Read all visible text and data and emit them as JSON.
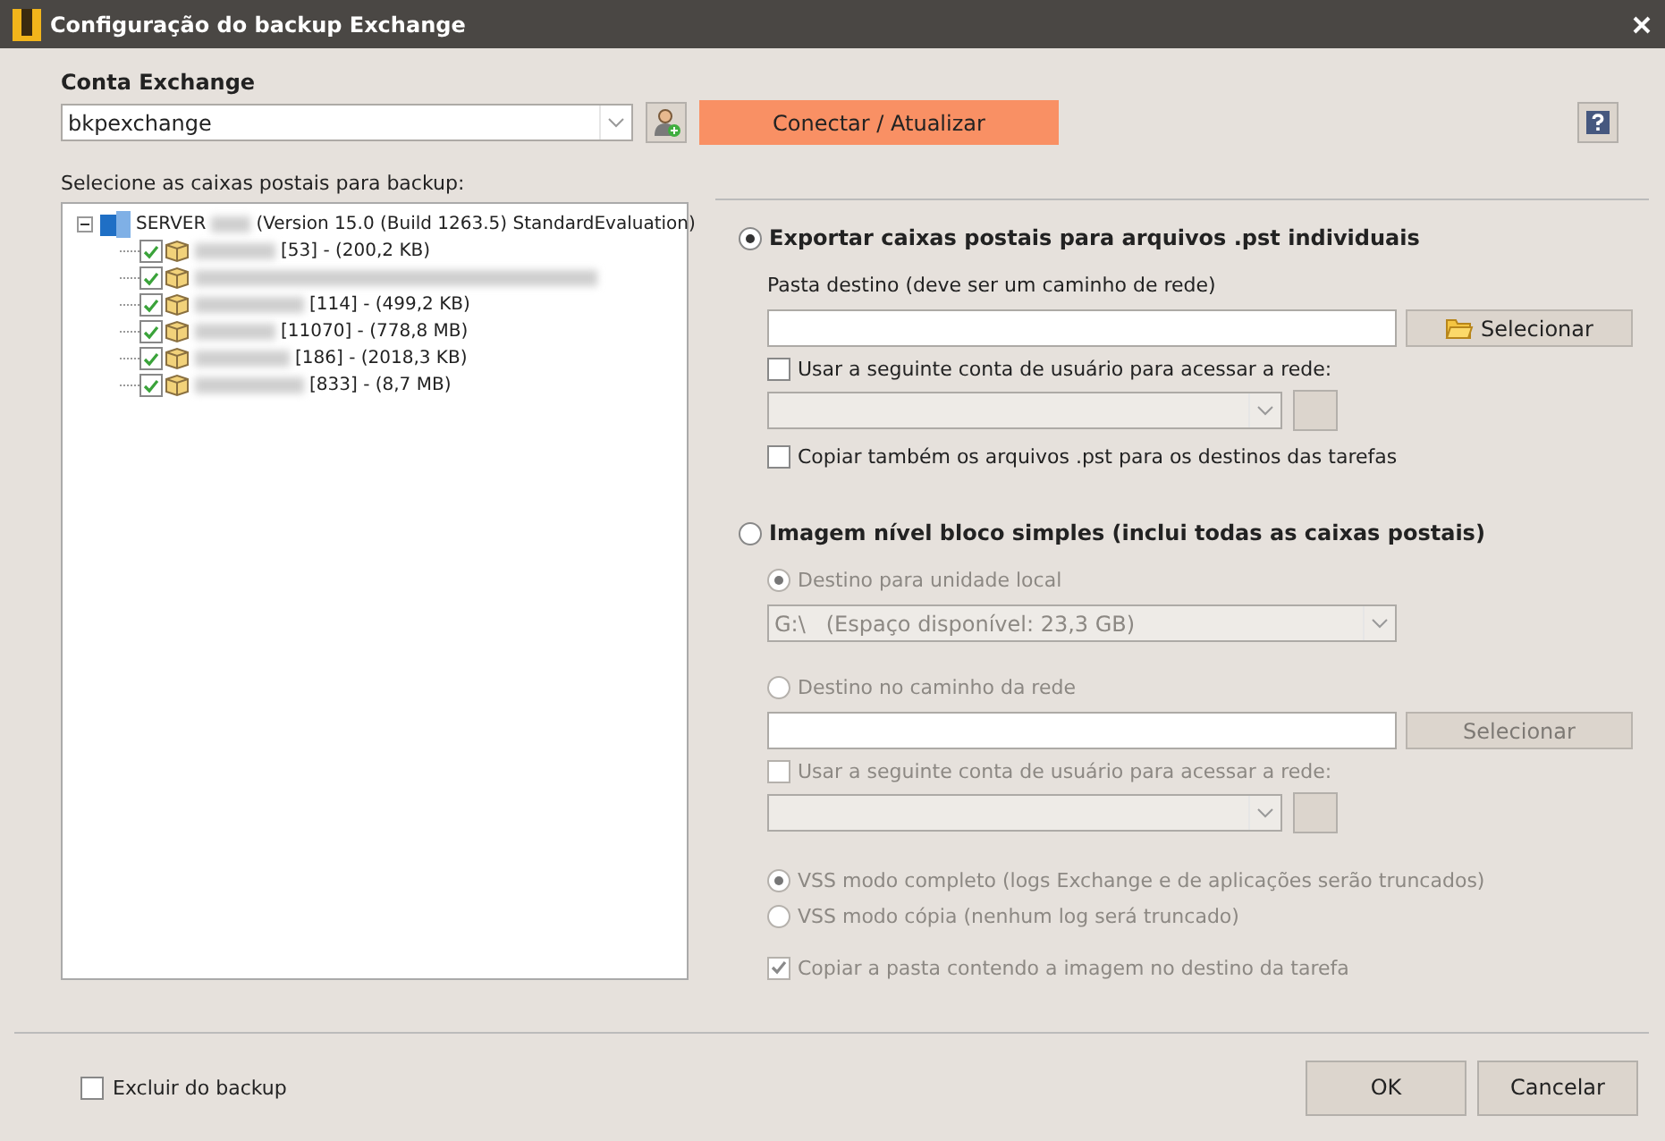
{
  "window": {
    "title": "Configuração do backup Exchange"
  },
  "account": {
    "label": "Conta Exchange",
    "value": "bkpexchange"
  },
  "connect_button": "Conectar / Atualizar",
  "mailbox_tree": {
    "label": "Selecione as caixas postais para backup:",
    "root": {
      "name": "SERVER",
      "detail": "(Version 15.0 (Build 1263.5) StandardEvaluation)",
      "expanded": true,
      "children": [
        {
          "detail": "[53] - (200,2 KB)",
          "checked": true
        },
        {
          "checked": true
        },
        {
          "detail": "[114] - (499,2 KB)",
          "checked": true
        },
        {
          "detail": "[11070] - (778,8 MB)",
          "checked": true
        },
        {
          "detail": "[186] - (2018,3 KB)",
          "checked": true
        },
        {
          "detail": "[833] - (8,7 MB)",
          "checked": true
        }
      ]
    }
  },
  "pst_export": {
    "label": "Exportar caixas postais para arquivos .pst individuais",
    "selected": true,
    "destination_label": "Pasta destino (deve ser um caminho de rede)",
    "select_button": "Selecionar",
    "use_account": {
      "label": "Usar a seguinte conta de usuário para acessar a rede:",
      "checked": false
    },
    "copy_pst": {
      "label": "Copiar também os arquivos .pst para os destinos das tarefas",
      "checked": false
    }
  },
  "image_backup": {
    "label": "Imagem nível bloco simples (inclui todas as caixas postais)",
    "selected": false,
    "disabled": true,
    "local_target": {
      "label": "Destino para unidade local",
      "selected": true,
      "drive": "G:\\   (Espaço disponível: 23,3 GB)"
    },
    "network_target": {
      "label": "Destino no caminho da rede",
      "selected": false,
      "select_button": "Selecionar"
    },
    "use_account": {
      "label": "Usar a seguinte conta de usuário para acessar a rede:",
      "checked": false
    },
    "vss_modes": [
      {
        "label": "VSS modo completo (logs Exchange e de aplicações serão truncados)",
        "selected": true
      },
      {
        "label": "VSS modo cópia (nenhum log será truncado)",
        "selected": false
      }
    ],
    "copy_image": {
      "label": "Copiar a pasta contendo a imagem no destino da tarefa",
      "checked": true
    }
  },
  "exclude": {
    "label": "Excluir do backup",
    "checked": false
  },
  "buttons": [
    "OK",
    "Cancelar"
  ]
}
